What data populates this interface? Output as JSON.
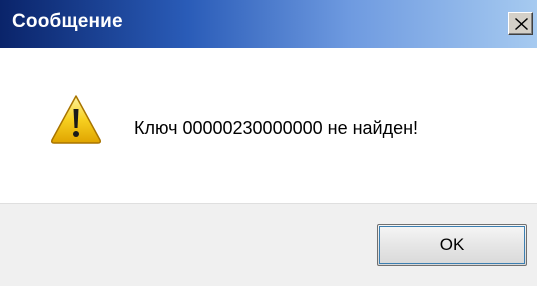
{
  "window": {
    "title": "Сообщение"
  },
  "message": {
    "text": "Ключ 00000230000000 не найден!",
    "icon": "warning-icon"
  },
  "buttons": {
    "ok_label": "OK"
  },
  "colors": {
    "titlebar_start": "#0a246a",
    "titlebar_end": "#a6caf0",
    "warning_yellow": "#f5c400",
    "footer_bg": "#f0f0f0"
  }
}
